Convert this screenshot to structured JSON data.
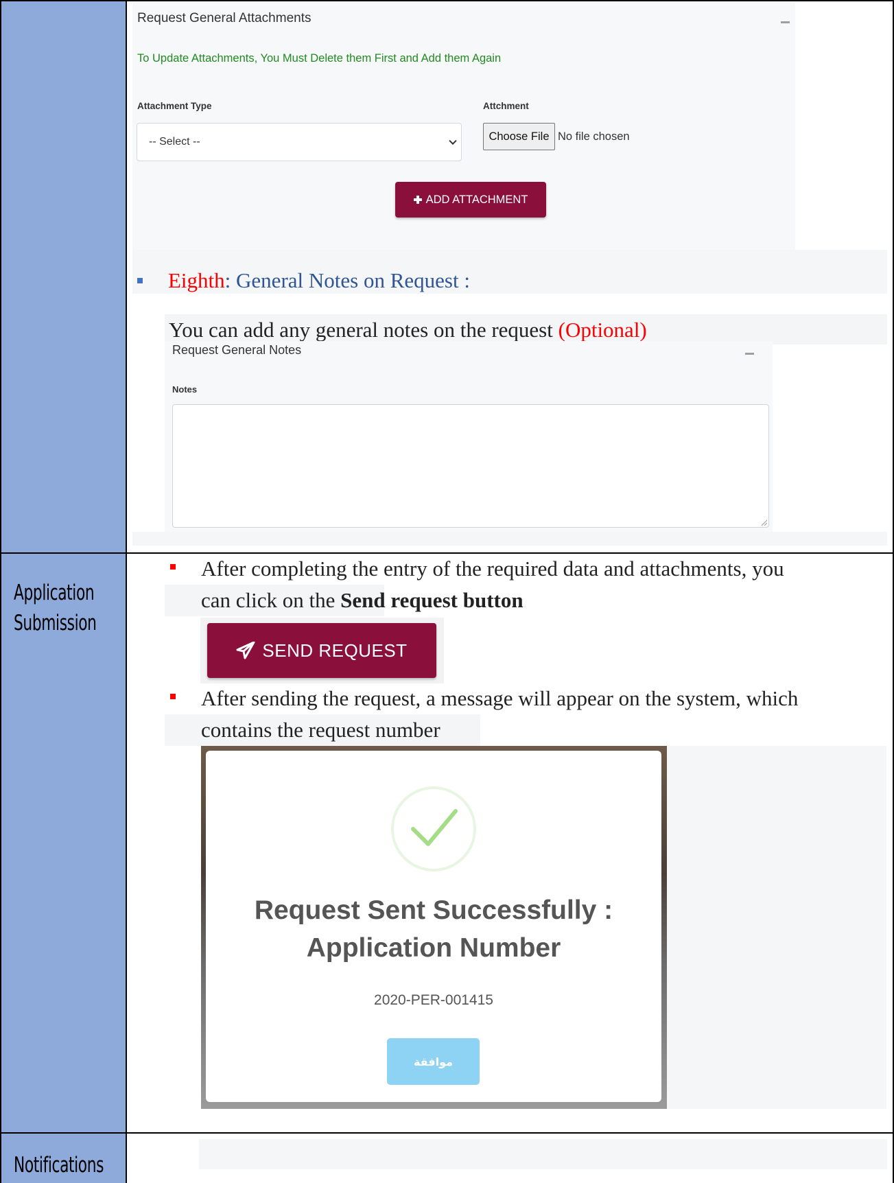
{
  "row_labels": {
    "application_submission": [
      "Application",
      "Submission"
    ],
    "notifications": "Notifications"
  },
  "attachments_panel": {
    "title": "Request General Attachments",
    "note": "To Update Attachments, You Must Delete them First and Add them Again",
    "attachment_type_label": "Attachment Type",
    "attachment_type_selected": "-- Select --",
    "attachment_label": "Attchment",
    "choose_file_label": "Choose File",
    "file_status": "No file chosen",
    "add_attachment_label": "ADD ATTACHMENT"
  },
  "section_eighth": {
    "prefix": "Eighth",
    "title": ": General Notes on Request :",
    "description": "You can add any general notes on the request",
    "optional": "(Optional)"
  },
  "notes_panel": {
    "title": "Request General Notes",
    "notes_label": "Notes",
    "notes_value": ""
  },
  "submission": {
    "step1_text": "After completing the entry of the required data and attachments, you",
    "step1_text_line2": "can click on the",
    "step1_bold": "Send request button",
    "send_request_label": "SEND REQUEST",
    "step2_text": "After sending the request, a message will appear on the system, which",
    "step2_text_line2": "contains the request number"
  },
  "modal": {
    "title_line1": "Request Sent Successfully :",
    "title_line2": "Application Number",
    "application_number": "2020-PER-001415",
    "ok_label": "موافقة"
  },
  "colors": {
    "left_column": "#8eaadb",
    "maroon": "#8a0f3a",
    "note_green": "#218a21",
    "heading_blue": "#2f5597",
    "accent_red": "#ff0000",
    "ok_button": "#8fd3f4"
  }
}
